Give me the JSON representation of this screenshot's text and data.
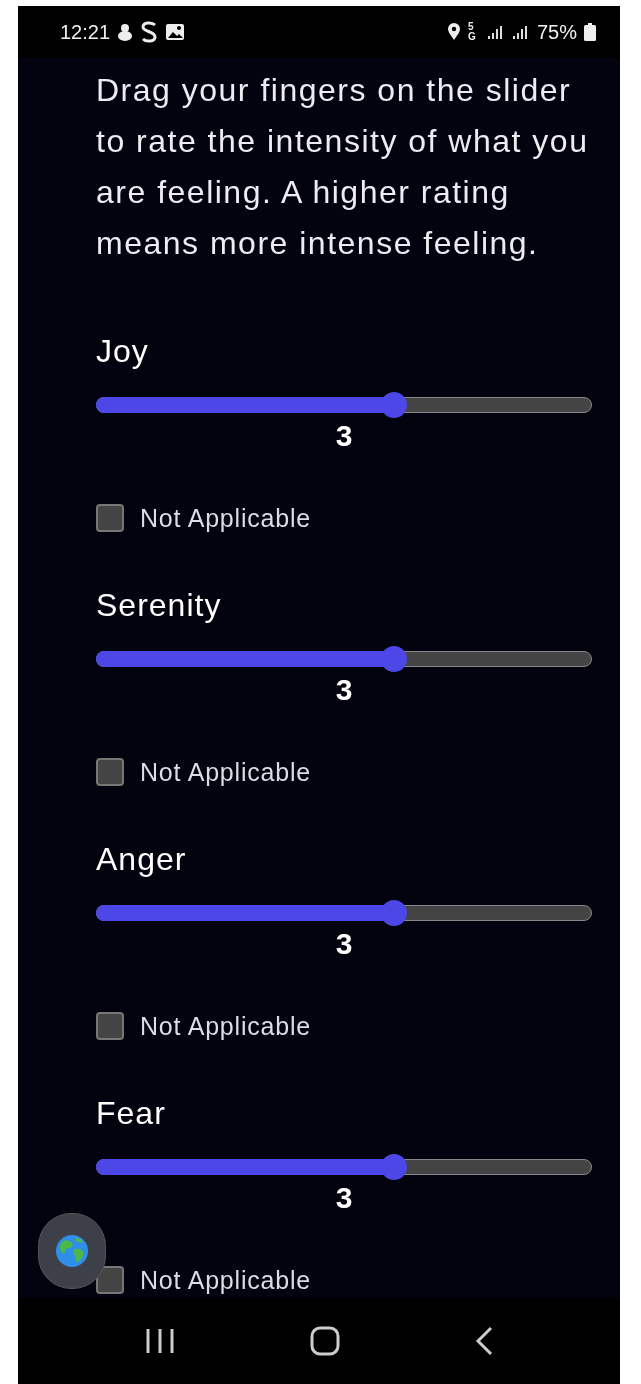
{
  "status_bar": {
    "time": "12:21",
    "network": "5G",
    "battery": "75%"
  },
  "instructions": "Drag your fingers on the slider to rate the intensity of what you are feeling. A higher rating means more intense feeling.",
  "emotions": [
    {
      "label": "Joy",
      "level": 0.6,
      "value": "3",
      "not_applicable": {
        "label": "Not Applicable",
        "checked": false
      }
    },
    {
      "label": "Serenity",
      "level": 0.6,
      "value": "3",
      "not_applicable": {
        "label": "Not Applicable",
        "checked": false
      }
    },
    {
      "label": "Anger",
      "level": 0.6,
      "value": "3",
      "not_applicable": {
        "label": "Not Applicable",
        "checked": false
      }
    },
    {
      "label": "Fear",
      "level": 0.6,
      "value": "3",
      "not_applicable": {
        "label": "Not Applicable",
        "checked": false
      }
    }
  ]
}
